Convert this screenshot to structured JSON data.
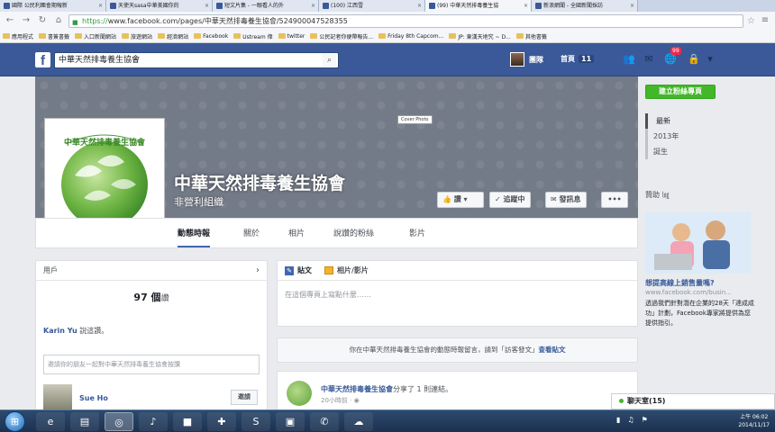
{
  "browser": {
    "tabs": [
      {
        "label": "國際 公民利團會期報新",
        "active": false
      },
      {
        "label": "天使天sasa中華美國你的",
        "active": false
      },
      {
        "label": "短文片集 - 一眼看人的外",
        "active": false
      },
      {
        "label": "(100) 江西雪",
        "active": false
      },
      {
        "label": "(99) 中華天然排毒養生協",
        "active": true
      },
      {
        "label": "新浪網聞 - 全國新聞採訪",
        "active": false
      }
    ],
    "url_scheme": "https://",
    "url_rest": "www.facebook.com/pages/中華天然排毒養生協會/524900047528355",
    "bookmarks": [
      "應用程式",
      "書簽書籤",
      "入口新聞網站",
      "旅遊網站",
      "經濟網站",
      "Facebook",
      "Ustream 偉",
      "twitter",
      "公民記者你便帶報告...",
      "Friday 8th Capcom...",
      "JP: 東漢天地究 ~ D...",
      "其他書籤"
    ]
  },
  "fb": {
    "search_value": "中華天然排毒養生協會",
    "user_name": "團隊",
    "home_label": "首頁",
    "home_count": "11",
    "notif_count": "99"
  },
  "page": {
    "name": "中華天然排毒養生協會",
    "category": "非營利組織",
    "cover_photo_label": "Cover Photo",
    "like_label": "讚",
    "following_label": "追蹤中",
    "message_label": "發訊息",
    "more_label": "•••",
    "tabs": [
      "動態時報",
      "關於",
      "相片",
      "說讚的粉絲",
      "影片"
    ]
  },
  "right": {
    "create_page_label": "建立粉絲專頁",
    "timeline_nav": [
      "最新",
      "2013年",
      "誕生"
    ],
    "sponsored_label": "贊助 ㏒",
    "ad_title": "想提高線上銷售量嗎?",
    "ad_url": "www.facebook.com/busin...",
    "ad_text": "透過我們針對潛在企業的28天「達成成功」計劃，Facebook專家將提供為您提供指引。"
  },
  "users_card": {
    "header": "用戶",
    "count": "97 個",
    "count_unit": "讚",
    "friend_name": "Karin Yu",
    "friend_suffix": "說這讚。",
    "invite_placeholder": "邀請你的朋友一起對中華天然排毒養生協會按讚",
    "suggest_name": "Sue Ho",
    "invite_button": "邀請"
  },
  "composer": {
    "tab_status": "貼文",
    "tab_photo": "相片/影片",
    "placeholder": "在這個專頁上寫點什麼……"
  },
  "notice": {
    "text": "你在中華天然排毒養生協會的動態時報留言，請到「訪客發文」",
    "link": "查看貼文"
  },
  "post": {
    "author": "中華天然排毒養生協會",
    "action": "分享了 1 則連結。",
    "time": "20小時前"
  },
  "chat": {
    "label": "聊天室(15)"
  },
  "taskbar": {
    "clock_time": "上午 06:02",
    "clock_date": "2014/11/17"
  }
}
